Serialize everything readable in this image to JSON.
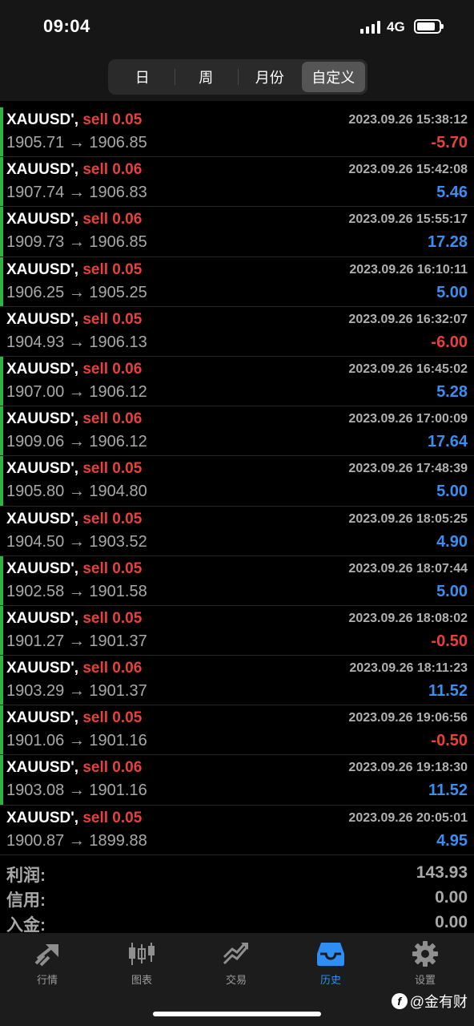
{
  "status_bar": {
    "time": "09:04",
    "network": "4G"
  },
  "segments": [
    {
      "label": "日",
      "active": false
    },
    {
      "label": "周",
      "active": false
    },
    {
      "label": "月份",
      "active": false
    },
    {
      "label": "自定义",
      "active": true
    }
  ],
  "trades": [
    {
      "symbol": "XAUUSD',",
      "side": "sell 0.05",
      "prices": "1905.71 → 1906.85",
      "datetime": "2023.09.26 15:38:12",
      "profit": "-5.70",
      "green": true
    },
    {
      "symbol": "XAUUSD',",
      "side": "sell 0.06",
      "prices": "1907.74 → 1906.83",
      "datetime": "2023.09.26 15:42:08",
      "profit": "5.46",
      "green": true
    },
    {
      "symbol": "XAUUSD',",
      "side": "sell 0.06",
      "prices": "1909.73 → 1906.85",
      "datetime": "2023.09.26 15:55:17",
      "profit": "17.28",
      "green": true
    },
    {
      "symbol": "XAUUSD',",
      "side": "sell 0.05",
      "prices": "1906.25 → 1905.25",
      "datetime": "2023.09.26 16:10:11",
      "profit": "5.00",
      "green": true
    },
    {
      "symbol": "XAUUSD',",
      "side": "sell 0.05",
      "prices": "1904.93 → 1906.13",
      "datetime": "2023.09.26 16:32:07",
      "profit": "-6.00",
      "green": false
    },
    {
      "symbol": "XAUUSD',",
      "side": "sell 0.06",
      "prices": "1907.00 → 1906.12",
      "datetime": "2023.09.26 16:45:02",
      "profit": "5.28",
      "green": true
    },
    {
      "symbol": "XAUUSD',",
      "side": "sell 0.06",
      "prices": "1909.06 → 1906.12",
      "datetime": "2023.09.26 17:00:09",
      "profit": "17.64",
      "green": true
    },
    {
      "symbol": "XAUUSD',",
      "side": "sell 0.05",
      "prices": "1905.80 → 1904.80",
      "datetime": "2023.09.26 17:48:39",
      "profit": "5.00",
      "green": true
    },
    {
      "symbol": "XAUUSD',",
      "side": "sell 0.05",
      "prices": "1904.50 → 1903.52",
      "datetime": "2023.09.26 18:05:25",
      "profit": "4.90",
      "green": false
    },
    {
      "symbol": "XAUUSD',",
      "side": "sell 0.05",
      "prices": "1902.58 → 1901.58",
      "datetime": "2023.09.26 18:07:44",
      "profit": "5.00",
      "green": true
    },
    {
      "symbol": "XAUUSD',",
      "side": "sell 0.05",
      "prices": "1901.27 → 1901.37",
      "datetime": "2023.09.26 18:08:02",
      "profit": "-0.50",
      "green": true
    },
    {
      "symbol": "XAUUSD',",
      "side": "sell 0.06",
      "prices": "1903.29 → 1901.37",
      "datetime": "2023.09.26 18:11:23",
      "profit": "11.52",
      "green": true
    },
    {
      "symbol": "XAUUSD',",
      "side": "sell 0.05",
      "prices": "1901.06 → 1901.16",
      "datetime": "2023.09.26 19:06:56",
      "profit": "-0.50",
      "green": true
    },
    {
      "symbol": "XAUUSD',",
      "side": "sell 0.06",
      "prices": "1903.08 → 1901.16",
      "datetime": "2023.09.26 19:18:30",
      "profit": "11.52",
      "green": true
    },
    {
      "symbol": "XAUUSD',",
      "side": "sell 0.05",
      "prices": "1900.87 → 1899.88",
      "datetime": "2023.09.26 20:05:01",
      "profit": "4.95",
      "green": false
    }
  ],
  "summary": [
    {
      "label": "利润:",
      "value": "143.93"
    },
    {
      "label": "信用:",
      "value": "0.00"
    },
    {
      "label": "入金:",
      "value": "0.00"
    }
  ],
  "tabs": [
    {
      "label": "行情",
      "icon": "quotes-icon",
      "active": false
    },
    {
      "label": "图表",
      "icon": "candlestick-chart-icon",
      "active": false
    },
    {
      "label": "交易",
      "icon": "trade-trend-icon",
      "active": false
    },
    {
      "label": "历史",
      "icon": "history-inbox-icon",
      "active": true
    },
    {
      "label": "设置",
      "icon": "gear-icon",
      "active": false
    }
  ],
  "watermark": "@金有财",
  "colors": {
    "profit_positive": "#3b8ef0",
    "profit_negative": "#e8413c",
    "sell": "#e8413c",
    "active_tab": "#2f8ef4",
    "row_marker": "#2fb443"
  }
}
